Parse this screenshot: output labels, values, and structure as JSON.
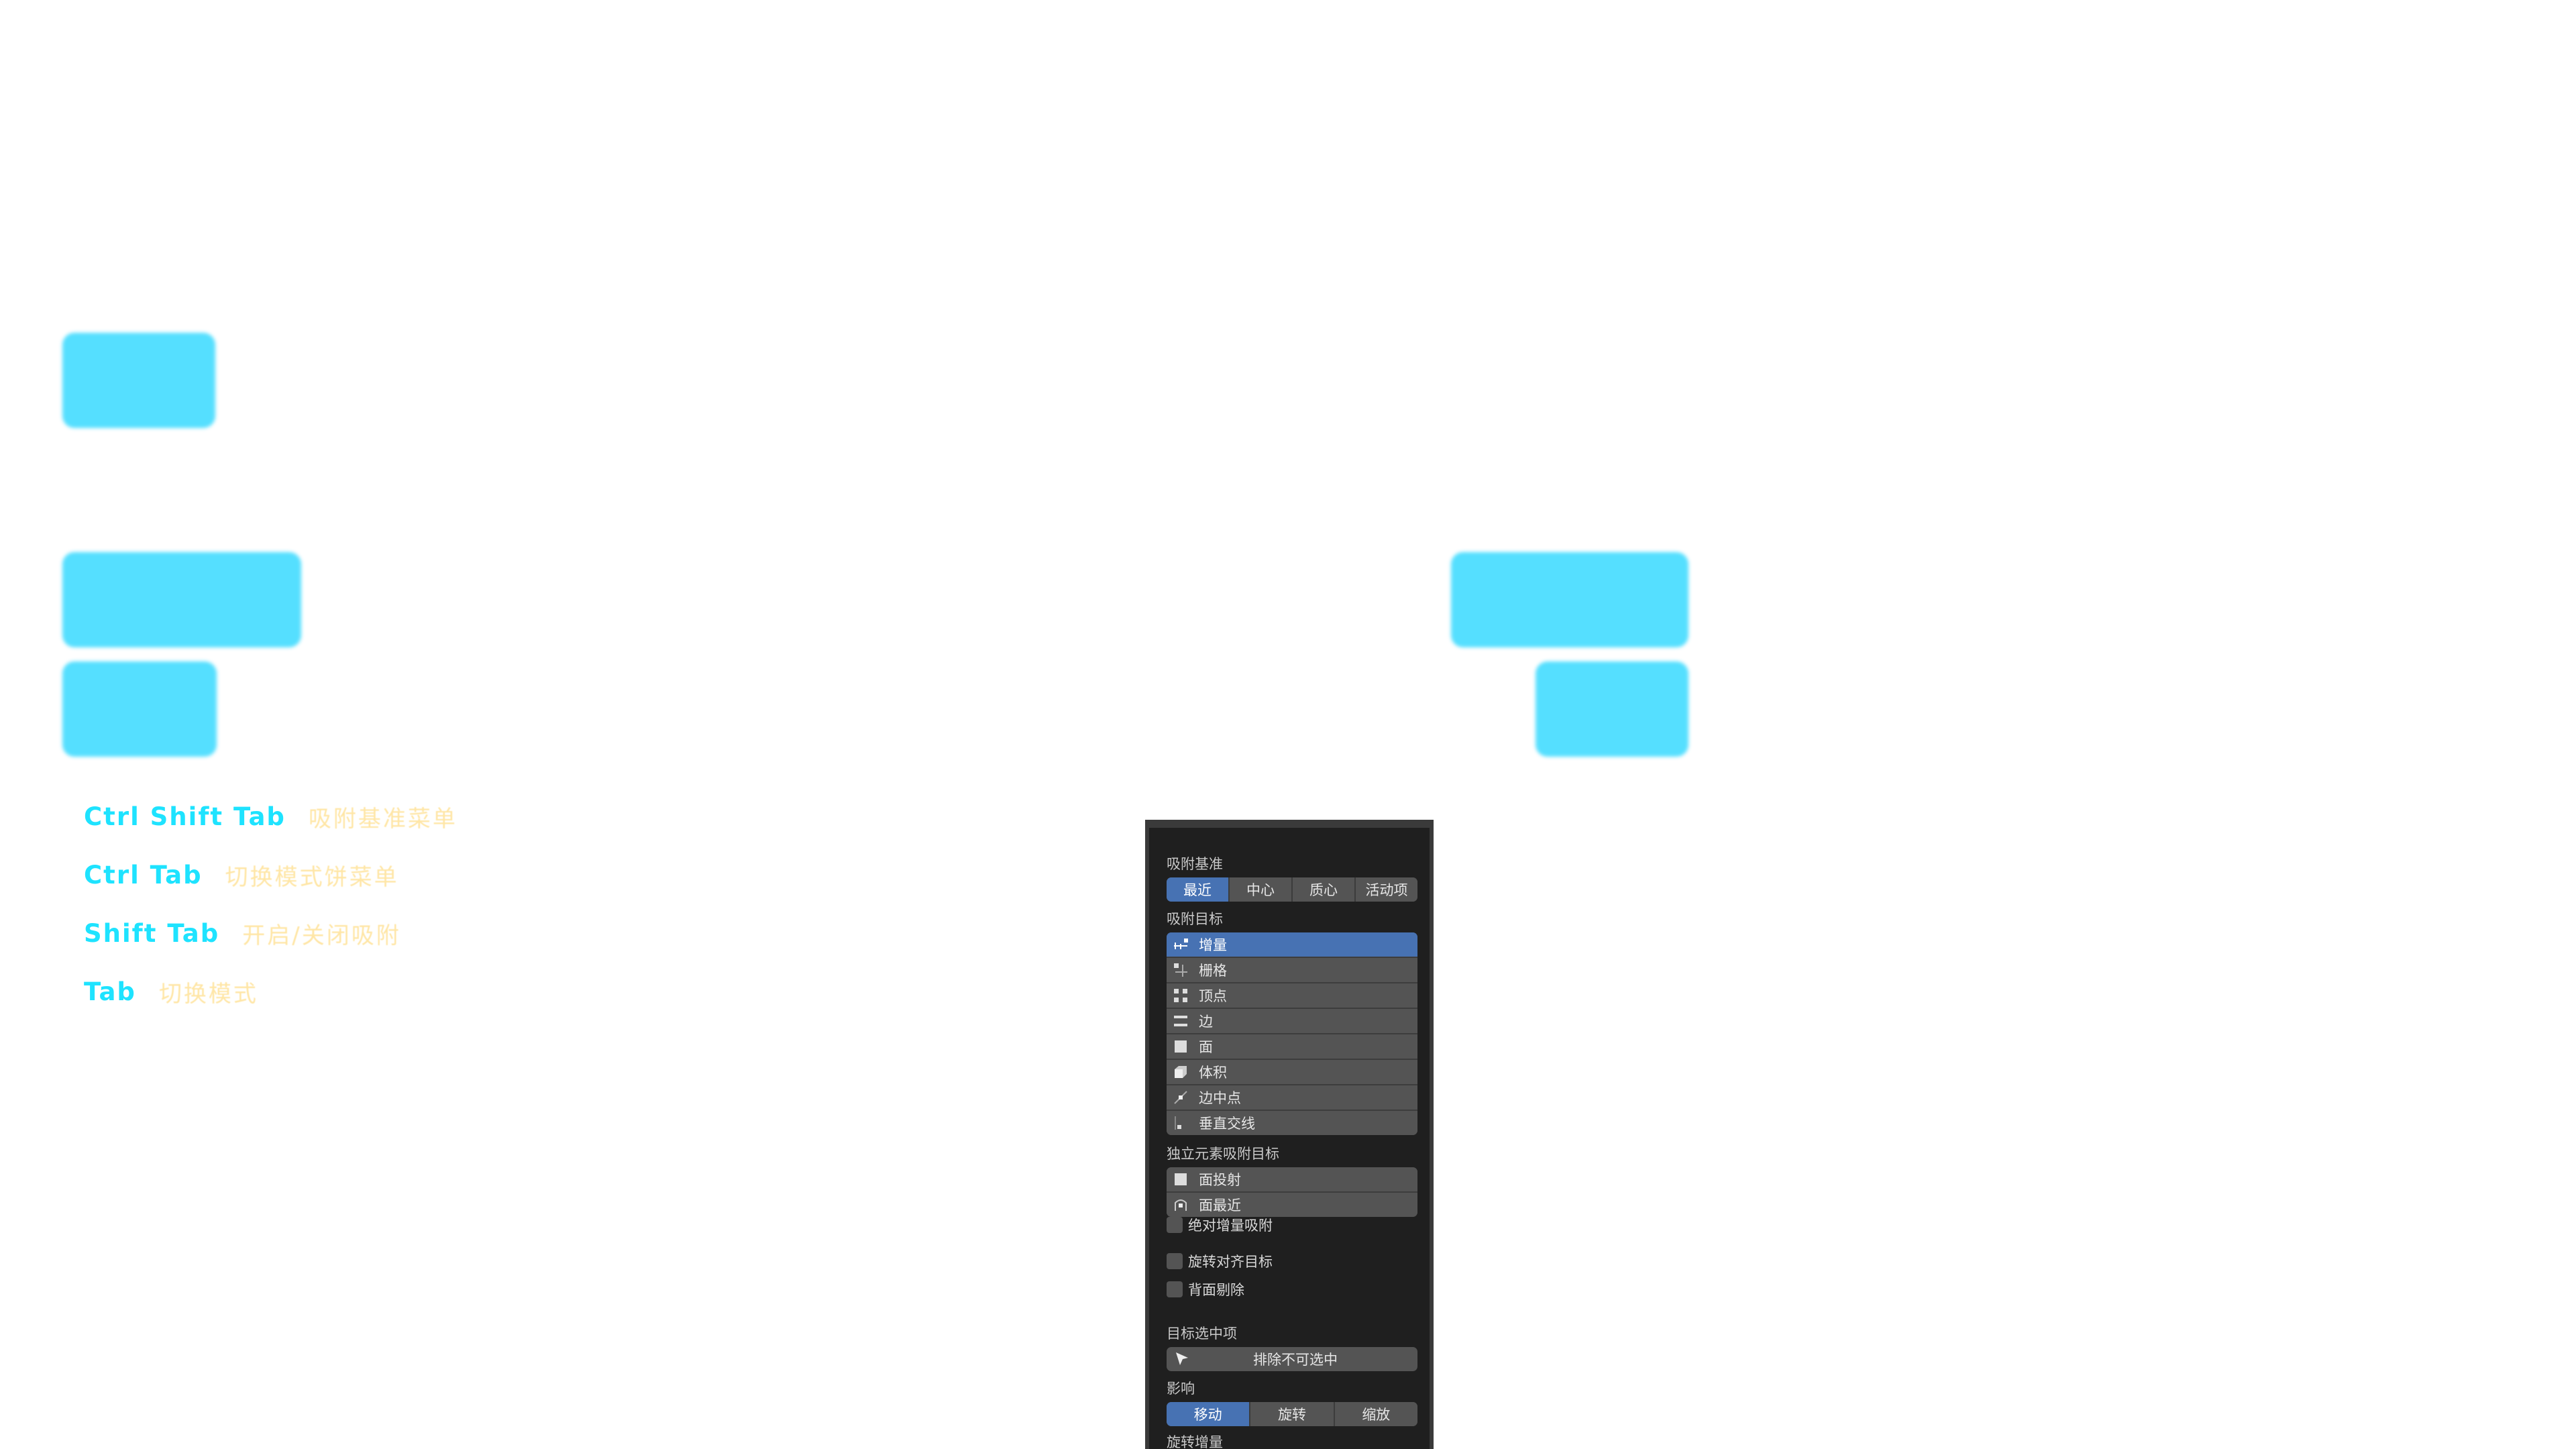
{
  "colors": {
    "cyan_block": "#55dfff",
    "shortcut_key": "#1ee3ff",
    "shortcut_desc": "#ffe6a6",
    "panel_bg": "#1f1f1f",
    "panel_active": "#4772b3",
    "panel_button": "#545454"
  },
  "shortcuts": [
    {
      "key": "Ctrl Shift Tab",
      "desc": "吸附基准菜单"
    },
    {
      "key": "Ctrl Tab",
      "desc": "切换模式饼菜单"
    },
    {
      "key": "Shift Tab",
      "desc": "开启/关闭吸附"
    },
    {
      "key": "Tab",
      "desc": "切换模式"
    }
  ],
  "snap_panel": {
    "snap_base": {
      "label": "吸附基准",
      "options": [
        "最近",
        "中心",
        "质心",
        "活动项"
      ],
      "selected": "最近"
    },
    "snap_target": {
      "label": "吸附目标",
      "items": [
        {
          "label": "增量",
          "icon": "increment-icon",
          "active": true
        },
        {
          "label": "栅格",
          "icon": "grid-icon",
          "active": false
        },
        {
          "label": "顶点",
          "icon": "vertex-icon",
          "active": false
        },
        {
          "label": "边",
          "icon": "edge-icon",
          "active": false
        },
        {
          "label": "面",
          "icon": "face-icon",
          "active": false
        },
        {
          "label": "体积",
          "icon": "volume-icon",
          "active": false
        },
        {
          "label": "边中点",
          "icon": "edge-midpoint-icon",
          "active": false
        },
        {
          "label": "垂直交线",
          "icon": "perpendicular-icon",
          "active": false
        }
      ]
    },
    "individual_target": {
      "label": "独立元素吸附目标",
      "items": [
        {
          "label": "面投射",
          "icon": "face-project-icon"
        },
        {
          "label": "面最近",
          "icon": "face-nearest-icon"
        }
      ]
    },
    "absolute_increment": "绝对增量吸附",
    "align_rotation": "旋转对齐目标",
    "backface_culling": "背面剔除",
    "target_selection": {
      "label": "目标选中项",
      "button": "排除不可选中"
    },
    "affect": {
      "label": "影响",
      "options": [
        "移动",
        "旋转",
        "缩放"
      ],
      "selected": "移动"
    },
    "rotation_increment": {
      "label": "旋转增量"
    }
  }
}
